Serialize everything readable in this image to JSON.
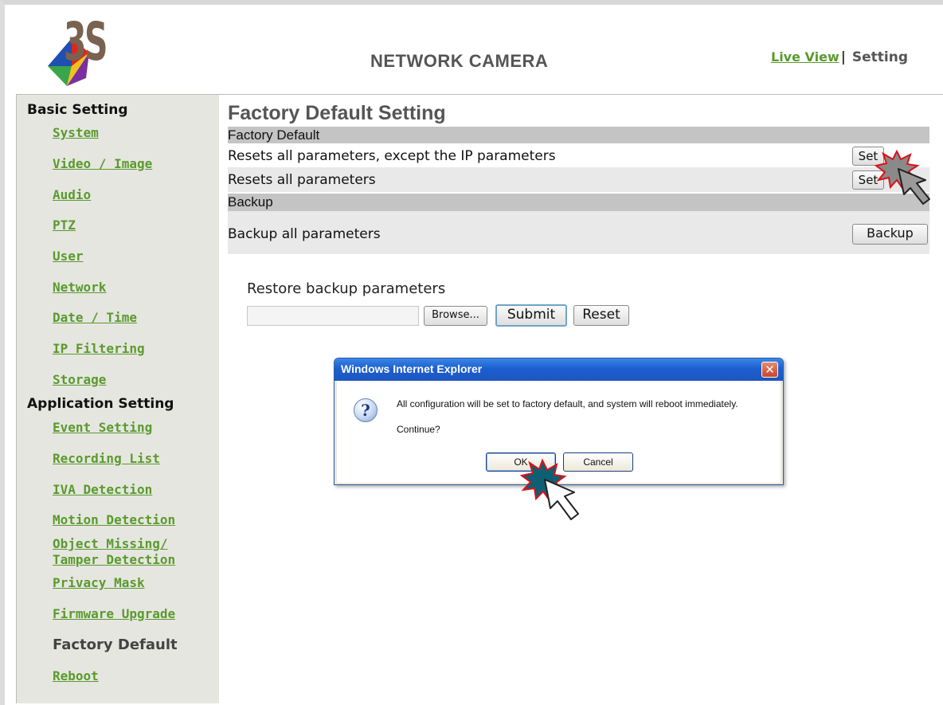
{
  "header": {
    "logo_text": "3S",
    "title": "NETWORK CAMERA",
    "nav_live_view": "Live View",
    "nav_separator": "|",
    "nav_setting": "Setting"
  },
  "sidebar": {
    "basic_title": "Basic Setting",
    "basic_items": [
      "System",
      "Video / Image",
      "Audio",
      "PTZ",
      "User",
      "Network",
      "Date / Time",
      "IP Filtering",
      "Storage"
    ],
    "application_title": "Application Setting",
    "application_items": [
      "Event Setting",
      "Recording List",
      "IVA Detection",
      "Motion Detection"
    ],
    "object_missing_line1": "Object Missing/",
    "object_missing_line2": "Tamper Detection",
    "application_items_after": [
      "Privacy Mask",
      "Firmware Upgrade"
    ],
    "current_item": "Factory Default",
    "last_item": "Reboot"
  },
  "main": {
    "page_title": "Factory Default Setting",
    "section_factory": "Factory Default",
    "row1_text": "Resets all parameters, except the IP parameters",
    "row1_button": "Set",
    "row2_text": "Resets all parameters",
    "row2_button": "Set",
    "section_backup": "Backup",
    "row3_text": "Backup all parameters",
    "row3_button": "Backup",
    "restore_label": "Restore backup parameters",
    "file_value": "",
    "browse_button": "Browse...",
    "submit_button": "Submit",
    "reset_button": "Reset"
  },
  "dialog": {
    "title": "Windows Internet Explorer",
    "close_glyph": "✕",
    "icon_glyph": "?",
    "message": "All configuration will be set to factory default, and system will reboot immediately.",
    "continue": "Continue?",
    "ok": "OK",
    "cancel": "Cancel"
  },
  "colors": {
    "link_green": "#5a9a2e",
    "sidebar_bg": "#e6e6e0",
    "section_bar": "#c4c4c4",
    "titlebar_blue": "#1c5fd0",
    "burst_red": "#d9121b",
    "burst_fill_teal": "#0e5f73",
    "burst_fill_gray": "#8a8a8a"
  }
}
